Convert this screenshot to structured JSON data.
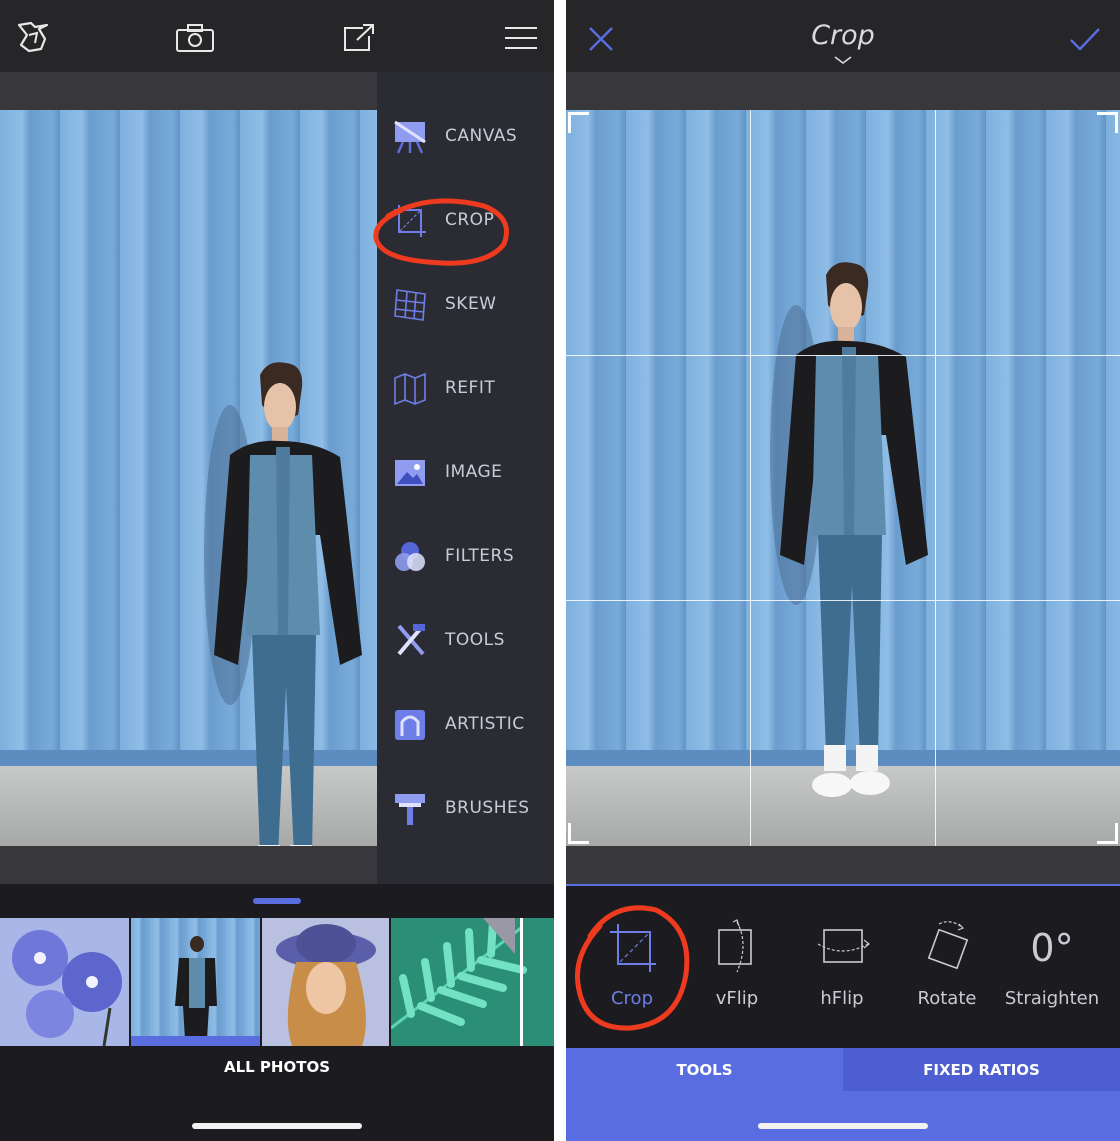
{
  "left_panel": {
    "menu": {
      "items": [
        {
          "label": "CANVAS",
          "icon": "canvas-easel-icon"
        },
        {
          "label": "CROP",
          "icon": "crop-icon"
        },
        {
          "label": "SKEW",
          "icon": "skew-grid-icon"
        },
        {
          "label": "REFIT",
          "icon": "refit-icon"
        },
        {
          "label": "IMAGE",
          "icon": "image-icon"
        },
        {
          "label": "FILTERS",
          "icon": "filters-icon"
        },
        {
          "label": "TOOLS",
          "icon": "tools-icon"
        },
        {
          "label": "ARTISTIC",
          "icon": "artistic-icon"
        },
        {
          "label": "BRUSHES",
          "icon": "brush-icon"
        }
      ]
    },
    "all_photos_label": "ALL PHOTOS"
  },
  "right_panel": {
    "title": "Crop",
    "tools": [
      {
        "label": "Crop",
        "icon": "crop-icon",
        "active": true
      },
      {
        "label": "vFlip",
        "icon": "vflip-icon",
        "active": false
      },
      {
        "label": "hFlip",
        "icon": "hflip-icon",
        "active": false
      },
      {
        "label": "Rotate",
        "icon": "rotate-icon",
        "active": false
      },
      {
        "label": "Straighten",
        "icon": "straighten-value",
        "value": "0°",
        "active": false
      }
    ],
    "tabs": [
      {
        "label": "TOOLS",
        "active": true
      },
      {
        "label": "FIXED RATIOS",
        "active": false
      }
    ]
  },
  "colors": {
    "accent": "#5a6de0",
    "highlight_circle": "#ee3b1f",
    "dark_bg": "#1c1c20",
    "menu_bg": "#2b2c33"
  }
}
